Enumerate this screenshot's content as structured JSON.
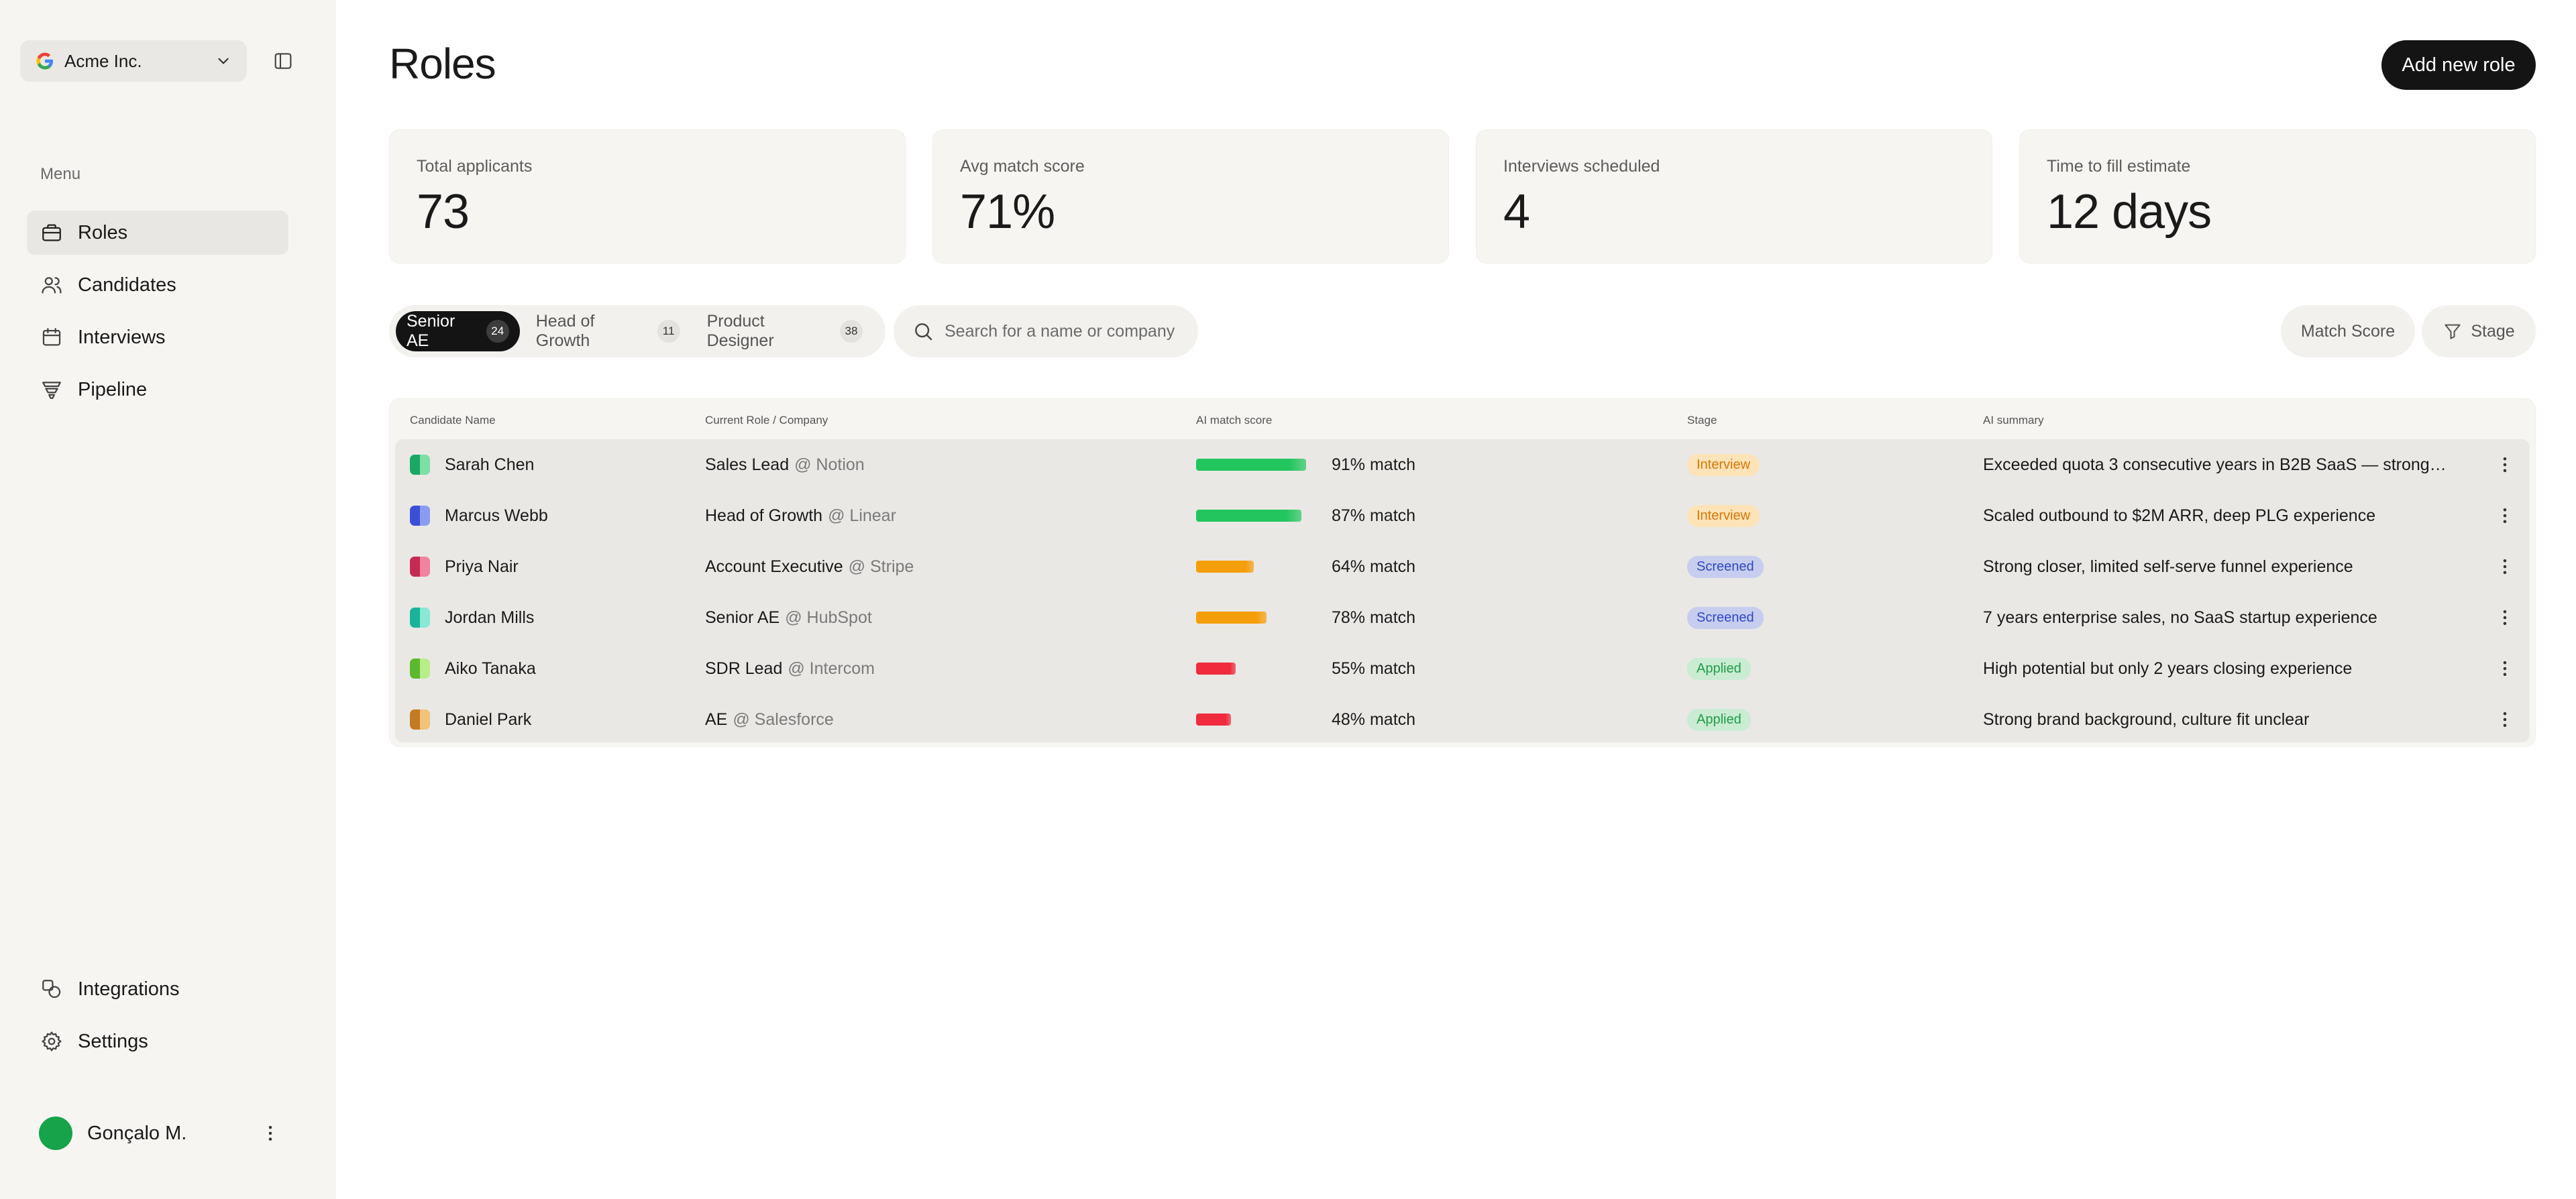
{
  "sidebar": {
    "workspace": "Acme Inc.",
    "menu_label": "Menu",
    "items": [
      {
        "label": "Roles",
        "icon": "briefcase-icon"
      },
      {
        "label": "Candidates",
        "icon": "users-icon"
      },
      {
        "label": "Interviews",
        "icon": "calendar-icon"
      },
      {
        "label": "Pipeline",
        "icon": "funnel-icon"
      }
    ],
    "bottom_items": [
      {
        "label": "Integrations",
        "icon": "integrations-icon"
      },
      {
        "label": "Settings",
        "icon": "gear-icon"
      }
    ],
    "user": {
      "name": "Gonçalo M.",
      "avatar_color": "#16a34a"
    }
  },
  "header": {
    "title": "Roles",
    "add_button": "Add new role"
  },
  "stats": [
    {
      "label": "Total applicants",
      "value": "73"
    },
    {
      "label": "Avg match score",
      "value": "71%"
    },
    {
      "label": "Interviews scheduled",
      "value": "4"
    },
    {
      "label": "Time to fill estimate",
      "value": "12 days"
    }
  ],
  "tabs": [
    {
      "label": "Senior AE",
      "count": "24"
    },
    {
      "label": "Head of Growth",
      "count": "11"
    },
    {
      "label": "Product Designer",
      "count": "38"
    }
  ],
  "search": {
    "placeholder": "Search for a name or company"
  },
  "filters": {
    "match_score": "Match Score",
    "stage": "Stage"
  },
  "table": {
    "headers": {
      "name": "Candidate Name",
      "role": "Current Role / Company",
      "score": "AI match score",
      "stage": "Stage",
      "summary": "AI summary"
    },
    "rows": [
      {
        "name": "Sarah Chen",
        "role": "Sales Lead",
        "company": "@ Notion",
        "score": 91,
        "score_label": "91% match",
        "stage": "Interview",
        "summary": "Exceeded quota 3 consecutive years in B2B SaaS — strong…",
        "icon_colors": [
          "#1aa866",
          "#7ddfa6"
        ]
      },
      {
        "name": "Marcus Webb",
        "role": "Head of Growth",
        "company": "@ Linear",
        "score": 87,
        "score_label": "87% match",
        "stage": "Interview",
        "summary": "Scaled outbound to $2M ARR, deep PLG experience",
        "icon_colors": [
          "#3b4fd6",
          "#8a9cf2"
        ]
      },
      {
        "name": "Priya Nair",
        "role": "Account Executive",
        "company": "@ Stripe",
        "score": 64,
        "score_label": "64% match",
        "stage": "Screened",
        "summary": "Strong closer, limited self-serve funnel experience",
        "icon_colors": [
          "#c42a52",
          "#f0849e"
        ]
      },
      {
        "name": "Jordan Mills",
        "role": "Senior AE",
        "company": "@ HubSpot",
        "score": 78,
        "score_label": "78% match",
        "stage": "Screened",
        "summary": "7 years enterprise sales, no SaaS startup experience",
        "icon_colors": [
          "#19b39a",
          "#8be8d6"
        ]
      },
      {
        "name": "Aiko Tanaka",
        "role": "SDR Lead",
        "company": "@ Intercom",
        "score": 55,
        "score_label": "55% match",
        "stage": "Applied",
        "summary": "High potential but only 2 years closing experience",
        "icon_colors": [
          "#5cb82e",
          "#b8ee8a"
        ]
      },
      {
        "name": "Daniel Park",
        "role": "AE",
        "company": "@ Salesforce",
        "score": 48,
        "score_label": "48% match",
        "stage": "Applied",
        "summary": "Strong brand background, culture fit unclear",
        "icon_colors": [
          "#c47a22",
          "#f1c27a"
        ]
      }
    ]
  },
  "colors": {
    "score_high": "#22c55e",
    "score_mid": "#f59e0b",
    "score_low": "#ef2b3d",
    "stage_interview_bg": "#fde3b8",
    "stage_interview_fg": "#d97706",
    "stage_screened_bg": "#c7cdee",
    "stage_screened_fg": "#2f47c8",
    "stage_applied_bg": "#c9ecd2",
    "stage_applied_fg": "#1f9d4a"
  }
}
